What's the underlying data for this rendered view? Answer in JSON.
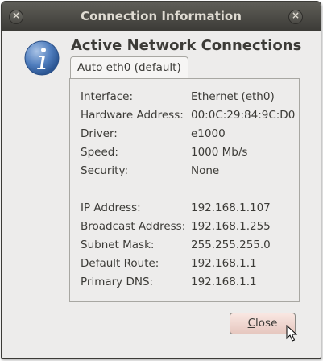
{
  "window": {
    "title": "Connection Information"
  },
  "heading": "Active Network Connections",
  "tab": {
    "label": "Auto eth0 (default)"
  },
  "details": [
    {
      "label": "Interface:",
      "value": "Ethernet (eth0)"
    },
    {
      "label": "Hardware Address:",
      "value": "00:0C:29:84:9C:D0"
    },
    {
      "label": "Driver:",
      "value": "e1000"
    },
    {
      "label": "Speed:",
      "value": "1000 Mb/s"
    },
    {
      "label": "Security:",
      "value": "None"
    },
    {
      "label": "IP Address:",
      "value": "192.168.1.107"
    },
    {
      "label": "Broadcast Address:",
      "value": "192.168.1.255"
    },
    {
      "label": "Subnet Mask:",
      "value": "255.255.255.0"
    },
    {
      "label": "Default Route:",
      "value": "192.168.1.1"
    },
    {
      "label": "Primary DNS:",
      "value": "192.168.1.1"
    }
  ],
  "buttons": {
    "close_first": "C",
    "close_rest": "lose"
  },
  "icons": {
    "info": "info-icon",
    "close_window": "close-icon",
    "cursor": "mouse-pointer-icon"
  }
}
